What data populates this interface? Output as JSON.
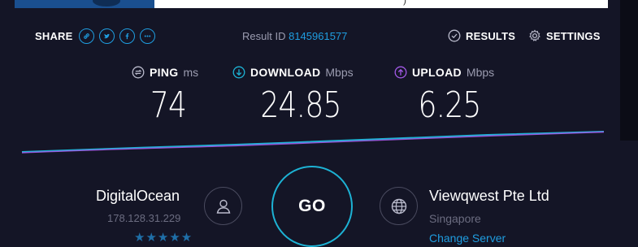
{
  "header": {
    "share_label": "SHARE",
    "result_label": "Result ID",
    "result_id": "8145961577",
    "results_label": "RESULTS",
    "settings_label": "SETTINGS"
  },
  "share_icons": [
    "link-icon",
    "twitter-icon",
    "facebook-icon",
    "more-icon"
  ],
  "metrics": {
    "ping": {
      "label": "PING",
      "unit": "ms",
      "value": "74"
    },
    "download": {
      "label": "DOWNLOAD",
      "unit": "Mbps",
      "value": "24.85"
    },
    "upload": {
      "label": "UPLOAD",
      "unit": "Mbps",
      "value": "6.25"
    }
  },
  "host": {
    "name": "DigitalOcean",
    "ip": "178.128.31.229",
    "rating": "★★★★★"
  },
  "go_label": "GO",
  "isp": {
    "name": "Viewqwest Pte Ltd",
    "location": "Singapore",
    "change_label": "Change Server"
  },
  "colors": {
    "accent": "#1f9de0",
    "download": "#1db2d4",
    "upload": "#a259e6",
    "background": "#141526"
  }
}
